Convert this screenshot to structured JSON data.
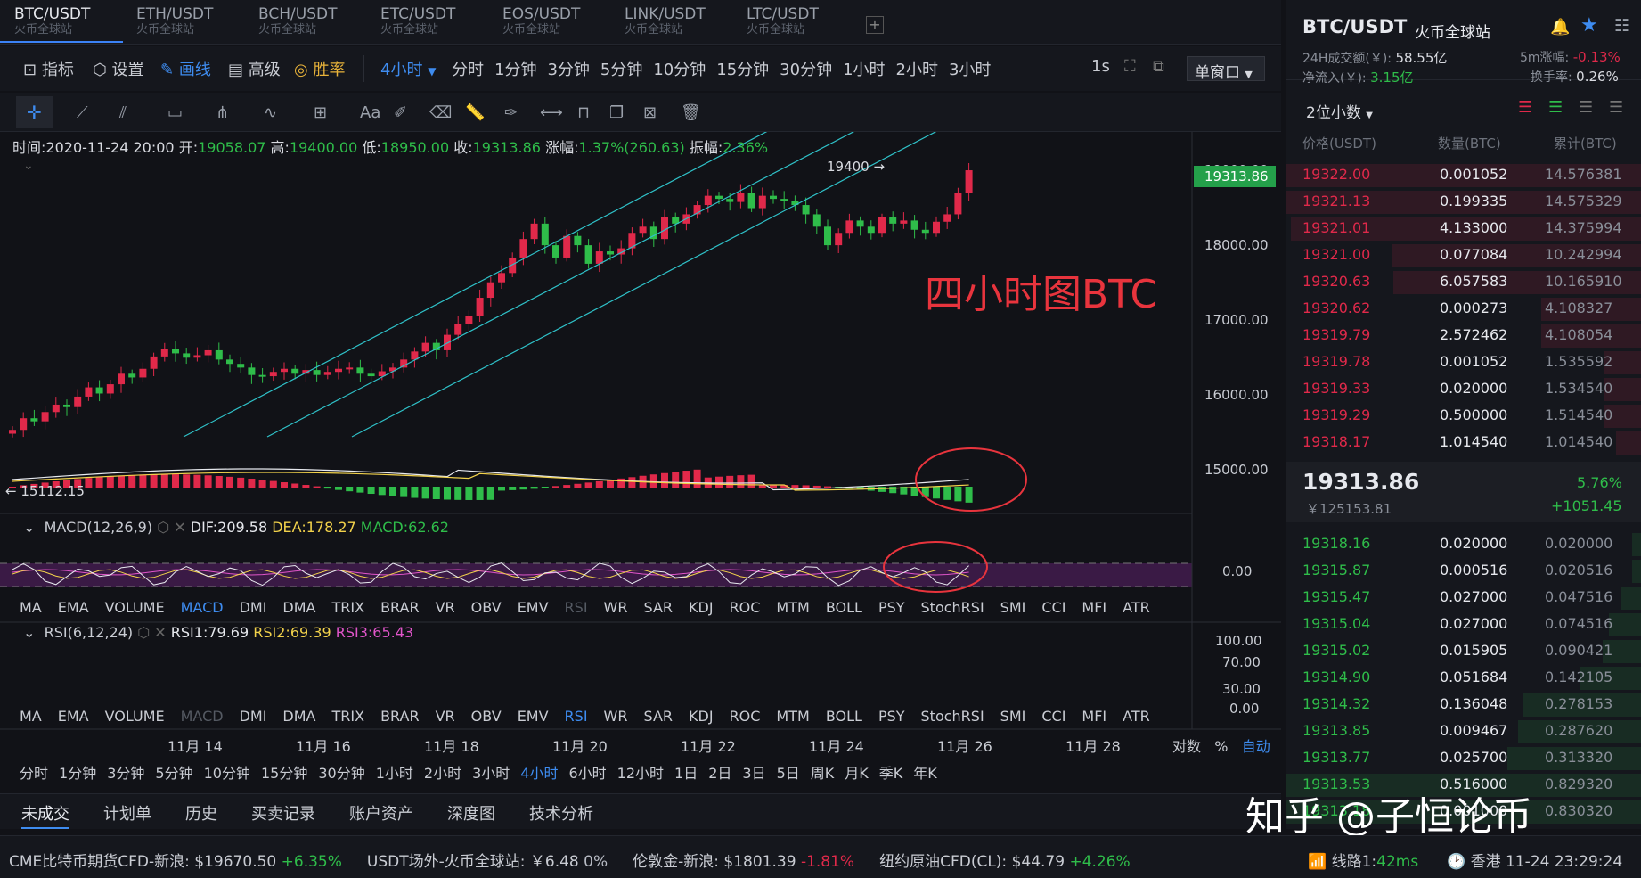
{
  "tabs": [
    {
      "pair": "BTC/USDT",
      "exchange": "火币全球站"
    },
    {
      "pair": "ETH/USDT",
      "exchange": "火币全球站"
    },
    {
      "pair": "BCH/USDT",
      "exchange": "火币全球站"
    },
    {
      "pair": "ETC/USDT",
      "exchange": "火币全球站"
    },
    {
      "pair": "EOS/USDT",
      "exchange": "火币全球站"
    },
    {
      "pair": "LINK/USDT",
      "exchange": "火币全球站"
    },
    {
      "pair": "LTC/USDT",
      "exchange": "火币全球站"
    }
  ],
  "toolbar": {
    "indicator": "指标",
    "settings": "设置",
    "draw": "画线",
    "advanced": "高级",
    "winrate": "胜率",
    "period_selected": "4小时",
    "periods": [
      "分时",
      "1分钟",
      "3分钟",
      "5分钟",
      "10分钟",
      "15分钟",
      "30分钟",
      "1小时",
      "2小时",
      "3小时"
    ],
    "refresh": "1s",
    "window_mode": "单窗口"
  },
  "ohlc": {
    "time_label": "时间:",
    "time": "2020-11-24 20:00",
    "open_label": "开:",
    "open": "19058.07",
    "high_label": "高:",
    "high": "19400.00",
    "low_label": "低:",
    "low": "18950.00",
    "close_label": "收:",
    "close": "19313.86",
    "change_label": "涨幅:",
    "change": "1.37%(260.63)",
    "amp_label": "振幅:",
    "amp": "2.36%"
  },
  "chart": {
    "price_ticks": [
      "19000.00",
      "18000.00",
      "17000.00",
      "16000.00",
      "15000.00"
    ],
    "current_price": "19313.86",
    "high_marker": "19400",
    "low_marker": "15112.15",
    "annotation": "四小时图BTC",
    "macd_tick": "0.00",
    "rsi_ticks": [
      "100.00",
      "70.00",
      "30.00",
      "0.00"
    ],
    "dates": [
      "11月 14",
      "11月 16",
      "11月 18",
      "11月 20",
      "11月 22",
      "11月 24",
      "11月 26",
      "11月 28"
    ],
    "scale_log": "对数",
    "scale_pct": "%",
    "scale_auto": "自动"
  },
  "macd": {
    "title": "MACD(12,26,9)",
    "dif": "DIF:209.58",
    "dea": "DEA:178.27",
    "macd": "MACD:62.62"
  },
  "rsi": {
    "title": "RSI(6,12,24)",
    "rsi1": "RSI1:79.69",
    "rsi2": "RSI2:69.39",
    "rsi3": "RSI3:65.43"
  },
  "indicator_tabs": [
    "MA",
    "EMA",
    "VOLUME",
    "MACD",
    "DMI",
    "DMA",
    "TRIX",
    "BRAR",
    "VR",
    "OBV",
    "EMV",
    "RSI",
    "WR",
    "SAR",
    "KDJ",
    "ROC",
    "MTM",
    "BOLL",
    "PSY",
    "StochRSI",
    "SMI",
    "CCI",
    "MFI",
    "ATR"
  ],
  "bottom_periods": [
    "分时",
    "1分钟",
    "3分钟",
    "5分钟",
    "10分钟",
    "15分钟",
    "30分钟",
    "1小时",
    "2小时",
    "3小时",
    "4小时",
    "6小时",
    "12小时",
    "1日",
    "2日",
    "3日",
    "5日",
    "周K",
    "月K",
    "季K",
    "年K"
  ],
  "bottom_tabs": [
    "未成交",
    "计划单",
    "历史",
    "买卖记录",
    "账户资产",
    "深度图",
    "技术分析"
  ],
  "right": {
    "pair": "BTC/USDT",
    "exchange": "火币全球站",
    "vol_label": "24H成交额(￥):",
    "vol": "58.55亿",
    "chg5_label": "5m涨幅:",
    "chg5": "-0.13%",
    "inflow_label": "净流入(￥):",
    "inflow": "3.15亿",
    "turnover_label": "换手率:",
    "turnover": "0.26%",
    "decimals": "2位小数",
    "headers": [
      "价格(USDT)",
      "数量(BTC)",
      "累计(BTC)"
    ],
    "asks": [
      [
        "19322.00",
        "0.001052",
        "14.576381"
      ],
      [
        "19321.13",
        "0.199335",
        "14.575329"
      ],
      [
        "19321.01",
        "4.133000",
        "14.375994"
      ],
      [
        "19321.00",
        "0.077084",
        "10.242994"
      ],
      [
        "19320.63",
        "6.057583",
        "10.165910"
      ],
      [
        "19320.62",
        "0.000273",
        "4.108327"
      ],
      [
        "19319.79",
        "2.572462",
        "4.108054"
      ],
      [
        "19319.78",
        "0.001052",
        "1.535592"
      ],
      [
        "19319.33",
        "0.020000",
        "1.534540"
      ],
      [
        "19319.29",
        "0.500000",
        "1.514540"
      ],
      [
        "19318.17",
        "1.014540",
        "1.014540"
      ]
    ],
    "last_price": "19313.86",
    "last_cny": "￥125153.81",
    "last_pct": "5.76%",
    "last_diff": "+1051.45",
    "bids": [
      [
        "19318.16",
        "0.020000",
        "0.020000"
      ],
      [
        "19315.87",
        "0.000516",
        "0.020516"
      ],
      [
        "19315.47",
        "0.027000",
        "0.047516"
      ],
      [
        "19315.04",
        "0.027000",
        "0.074516"
      ],
      [
        "19315.02",
        "0.015905",
        "0.090421"
      ],
      [
        "19314.90",
        "0.051684",
        "0.142105"
      ],
      [
        "19314.32",
        "0.136048",
        "0.278153"
      ],
      [
        "19313.85",
        "0.009467",
        "0.287620"
      ],
      [
        "19313.77",
        "0.025700",
        "0.313320"
      ],
      [
        "19313.53",
        "0.516000",
        "0.829320"
      ],
      [
        "19313.18",
        "0.001000",
        "0.830320"
      ]
    ]
  },
  "watermark": "知乎 @子恒论币",
  "status": [
    {
      "name": "CME比特币期货CFD-新浪:",
      "value": "$19670.50",
      "chg": "+6.35%",
      "color": "#2fbd4a"
    },
    {
      "name": "USDT场外-火币全球站:",
      "value": "￥6.48",
      "chg": "0%",
      "color": "#b8bcc5"
    },
    {
      "name": "伦敦金-新浪:",
      "value": "$1801.39",
      "chg": "-1.81%",
      "color": "#e0294a"
    },
    {
      "name": "纽约原油CFD(CL):",
      "value": "$44.79",
      "chg": "+4.26%",
      "color": "#2fbd4a"
    }
  ],
  "line": {
    "label": "线路1:",
    "ms": "42ms"
  },
  "clock": "香港 11-24 23:29:24",
  "colors": {
    "up": "#2fbd4a",
    "down": "#e0294a",
    "accent": "#3e8cf0",
    "channel": "#2fc1c8"
  }
}
